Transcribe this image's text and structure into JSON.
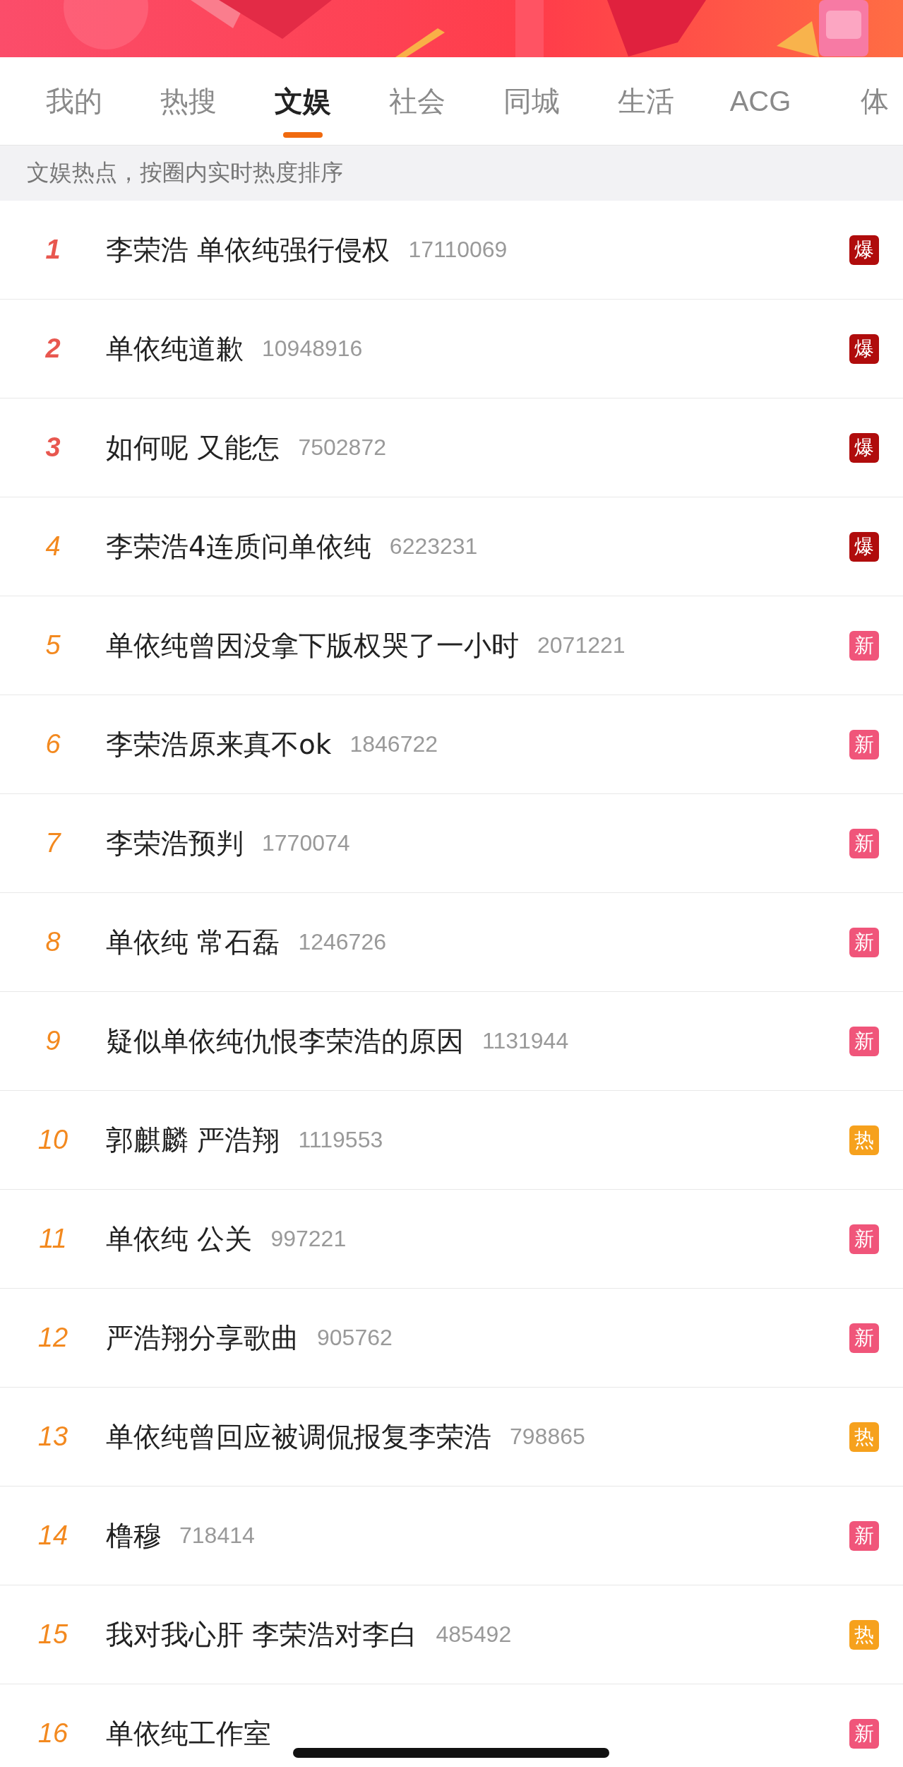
{
  "tabs": [
    {
      "label": "我的",
      "selected": false
    },
    {
      "label": "热搜",
      "selected": false
    },
    {
      "label": "文娱",
      "selected": true
    },
    {
      "label": "社会",
      "selected": false
    },
    {
      "label": "同城",
      "selected": false
    },
    {
      "label": "生活",
      "selected": false
    },
    {
      "label": "ACG",
      "selected": false
    },
    {
      "label": "体",
      "selected": false
    }
  ],
  "subtitle": "文娱热点，按圈内实时热度排序",
  "rows": [
    {
      "rank": "1",
      "title": "李荣浩 单依纯强行侵权",
      "count": "17110069",
      "badge": "爆",
      "kind": "boom"
    },
    {
      "rank": "2",
      "title": "单依纯道歉",
      "count": "10948916",
      "badge": "爆",
      "kind": "boom"
    },
    {
      "rank": "3",
      "title": "如何呢 又能怎",
      "count": "7502872",
      "badge": "爆",
      "kind": "boom"
    },
    {
      "rank": "4",
      "title": "李荣浩4连质问单依纯",
      "count": "6223231",
      "badge": "爆",
      "kind": "boom"
    },
    {
      "rank": "5",
      "title": "单依纯曾因没拿下版权哭了一小时",
      "count": "2071221",
      "badge": "新",
      "kind": "new"
    },
    {
      "rank": "6",
      "title": "李荣浩原来真不ok",
      "count": "1846722",
      "badge": "新",
      "kind": "new"
    },
    {
      "rank": "7",
      "title": "李荣浩预判",
      "count": "1770074",
      "badge": "新",
      "kind": "new"
    },
    {
      "rank": "8",
      "title": "单依纯 常石磊",
      "count": "1246726",
      "badge": "新",
      "kind": "new"
    },
    {
      "rank": "9",
      "title": "疑似单依纯仇恨李荣浩的原因",
      "count": "1131944",
      "badge": "新",
      "kind": "new"
    },
    {
      "rank": "10",
      "title": "郭麒麟 严浩翔",
      "count": "1119553",
      "badge": "热",
      "kind": "hot"
    },
    {
      "rank": "11",
      "title": "单依纯 公关",
      "count": "997221",
      "badge": "新",
      "kind": "new"
    },
    {
      "rank": "12",
      "title": "严浩翔分享歌曲",
      "count": "905762",
      "badge": "新",
      "kind": "new"
    },
    {
      "rank": "13",
      "title": "单依纯曾回应被调侃报复李荣浩",
      "count": "798865",
      "badge": "热",
      "kind": "hot"
    },
    {
      "rank": "14",
      "title": "橹穆",
      "count": "718414",
      "badge": "新",
      "kind": "new"
    },
    {
      "rank": "15",
      "title": "我对我心肝 李荣浩对李白",
      "count": "485492",
      "badge": "热",
      "kind": "hot"
    },
    {
      "rank": "16",
      "title": "单依纯工作室",
      "badge": "新",
      "kind": "new"
    }
  ]
}
